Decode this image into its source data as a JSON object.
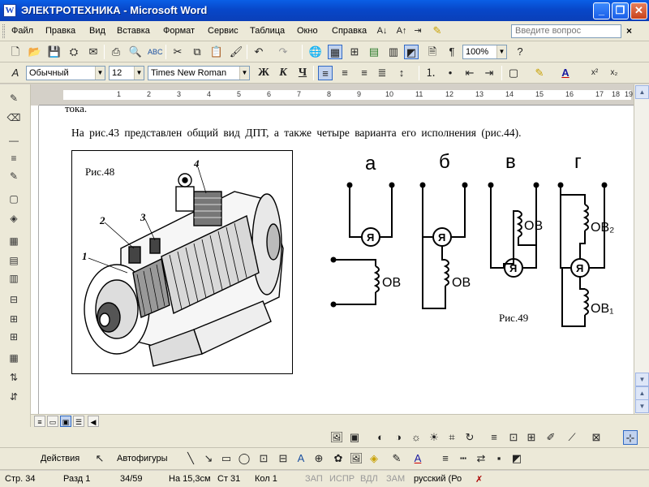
{
  "window": {
    "title": "ЭЛЕКТРОТЕХНИКА - Microsoft Word",
    "app_icon": "W",
    "minimize": "_",
    "maximize": "❐",
    "close": "✕"
  },
  "menu": {
    "items": [
      "Файл",
      "Правка",
      "Вид",
      "Вставка",
      "Формат",
      "Сервис",
      "Таблица",
      "Окно",
      "Справка"
    ],
    "help_placeholder": "Введите вопрос",
    "close_label": "×"
  },
  "formatting": {
    "style": "Обычный",
    "size": "12",
    "font": "Times New Roman",
    "bold": "Ж",
    "italic": "К",
    "underline": "Ч",
    "superscript": "x²",
    "subscript": "x₂"
  },
  "standard": {
    "zoom": "100%"
  },
  "document": {
    "cut_line": "тока.",
    "paragraph": "На рис.43  представлен общий вид  ДПТ, а  также  четыре  варианта  его исполнения  (рис.44).",
    "fig48": {
      "caption": "Рис.48",
      "callouts": [
        "1",
        "2",
        "3",
        "4"
      ]
    },
    "fig49": {
      "caption": "Рис.49",
      "variants": [
        "а",
        "б",
        "в",
        "г"
      ],
      "armature": "Я",
      "field": "ОВ",
      "field_sub_top": "ОВ₂",
      "field_sub_bottom": "ОВ₁"
    }
  },
  "draw": {
    "actions": "Действия",
    "autoshapes": "Автофигуры"
  },
  "status": {
    "page": "Стр.  34",
    "section": "Разд  1",
    "pages": "34/59",
    "at": "На  15,3см",
    "line": "Ст  31",
    "col": "Кол  1",
    "rec": "ЗАП",
    "trk": "ИСПР",
    "ext": "ВДЛ",
    "ovr": "ЗАМ",
    "lang": "русский (Ро"
  },
  "ruler": [
    1,
    2,
    3,
    4,
    5,
    6,
    7,
    8,
    9,
    10,
    11,
    12,
    13,
    14,
    15,
    16,
    17,
    18,
    19
  ]
}
